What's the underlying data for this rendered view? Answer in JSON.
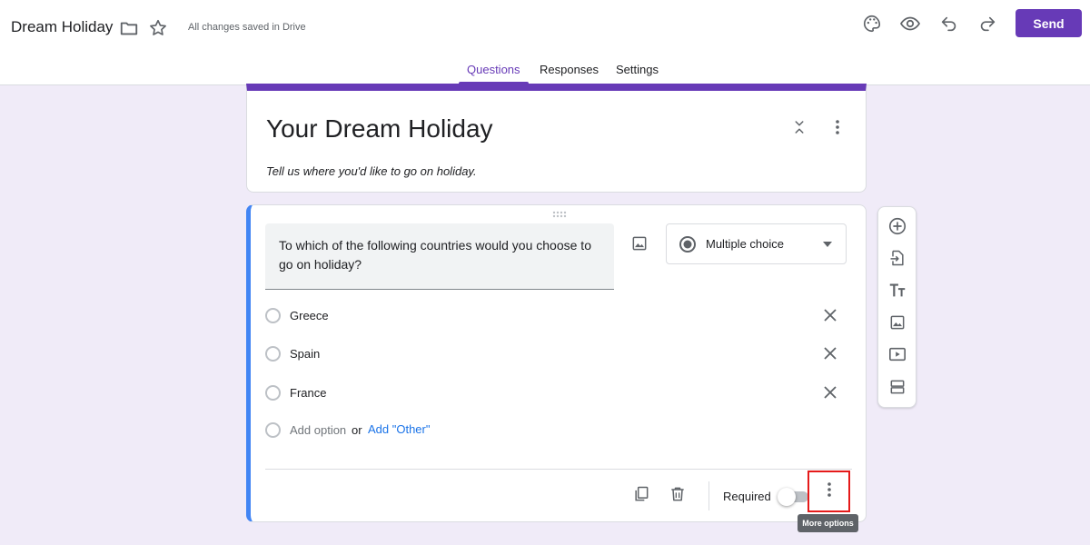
{
  "header": {
    "doc_title": "Dream Holiday",
    "save_status": "All changes saved in Drive",
    "send_label": "Send",
    "tabs": [
      "Questions",
      "Responses",
      "Settings"
    ],
    "active_tab": "Questions",
    "icons": [
      "folder-icon",
      "star-icon",
      "palette-icon",
      "preview-eye-icon",
      "undo-icon",
      "redo-icon"
    ]
  },
  "form": {
    "title": "Your Dream Holiday",
    "description": "Tell us where you'd like to go on holiday."
  },
  "question": {
    "text": "To which of the following countries would you choose to go on holiday?",
    "type": "Multiple choice",
    "options": [
      {
        "label": "Greece"
      },
      {
        "label": "Spain"
      },
      {
        "label": "France"
      }
    ],
    "add_option": "Add option",
    "or_text": "or",
    "add_other": "Add \"Other\"",
    "required_label": "Required",
    "required": false
  },
  "tooltip": {
    "more_options": "More options"
  },
  "side_toolbar": [
    "add-question-icon",
    "import-questions-icon",
    "add-title-icon",
    "add-image-icon",
    "add-video-icon",
    "add-section-icon"
  ],
  "colors": {
    "accent": "#673ab7",
    "background": "#f0ebf8",
    "active_question_border": "#4285f4",
    "link": "#1a73e8",
    "highlight_box": "#e51a1a"
  }
}
